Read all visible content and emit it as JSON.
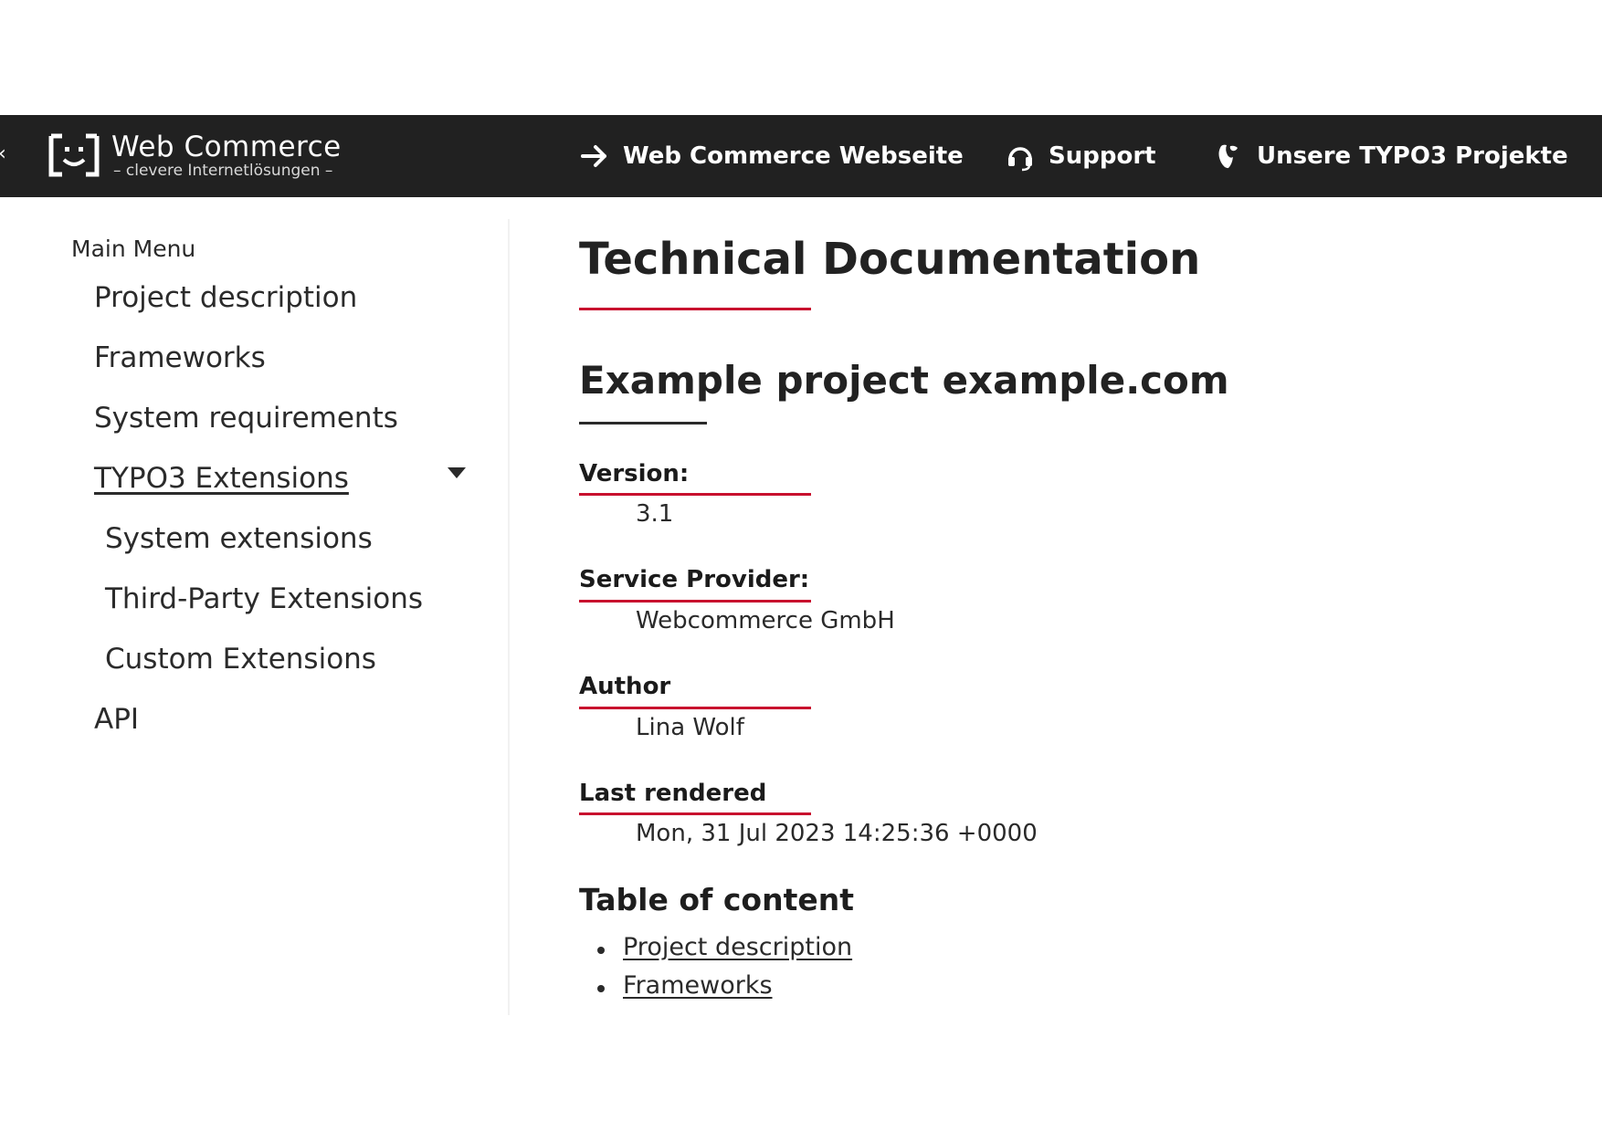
{
  "header": {
    "logo_title": "Web Commerce",
    "logo_subtitle": "– clevere Internetlösungen –",
    "nav": [
      {
        "label": "Web Commerce Webseite",
        "icon": "arrow-right-icon"
      },
      {
        "label": "Support",
        "icon": "headset-icon"
      },
      {
        "label": "Unsere TYPO3 Projekte",
        "icon": "typo3-icon"
      }
    ],
    "edge_glyph": "‹"
  },
  "sidebar": {
    "title": "Main Menu",
    "items": [
      {
        "label": "Project description"
      },
      {
        "label": "Frameworks"
      },
      {
        "label": "System requirements"
      },
      {
        "label": "TYPO3 Extensions",
        "expanded": true
      },
      {
        "label": "System extensions"
      },
      {
        "label": "Third-Party Extensions"
      },
      {
        "label": "Custom Extensions"
      },
      {
        "label": "API"
      }
    ]
  },
  "main": {
    "title": "Technical Documentation",
    "project_title": "Example project example.com",
    "fields": [
      {
        "label": "Version:",
        "value": "3.1"
      },
      {
        "label": "Service Provider:",
        "value": "Webcommerce GmbH"
      },
      {
        "label": "Author",
        "value": "Lina Wolf"
      },
      {
        "label": "Last rendered",
        "value": "Mon, 31 Jul 2023 14:25:36 +0000"
      }
    ],
    "toc_title": "Table of content",
    "toc": [
      {
        "label": "Project description"
      },
      {
        "label": "Frameworks"
      }
    ]
  },
  "colors": {
    "header_bg": "#212121",
    "accent_red": "#c8102e"
  }
}
